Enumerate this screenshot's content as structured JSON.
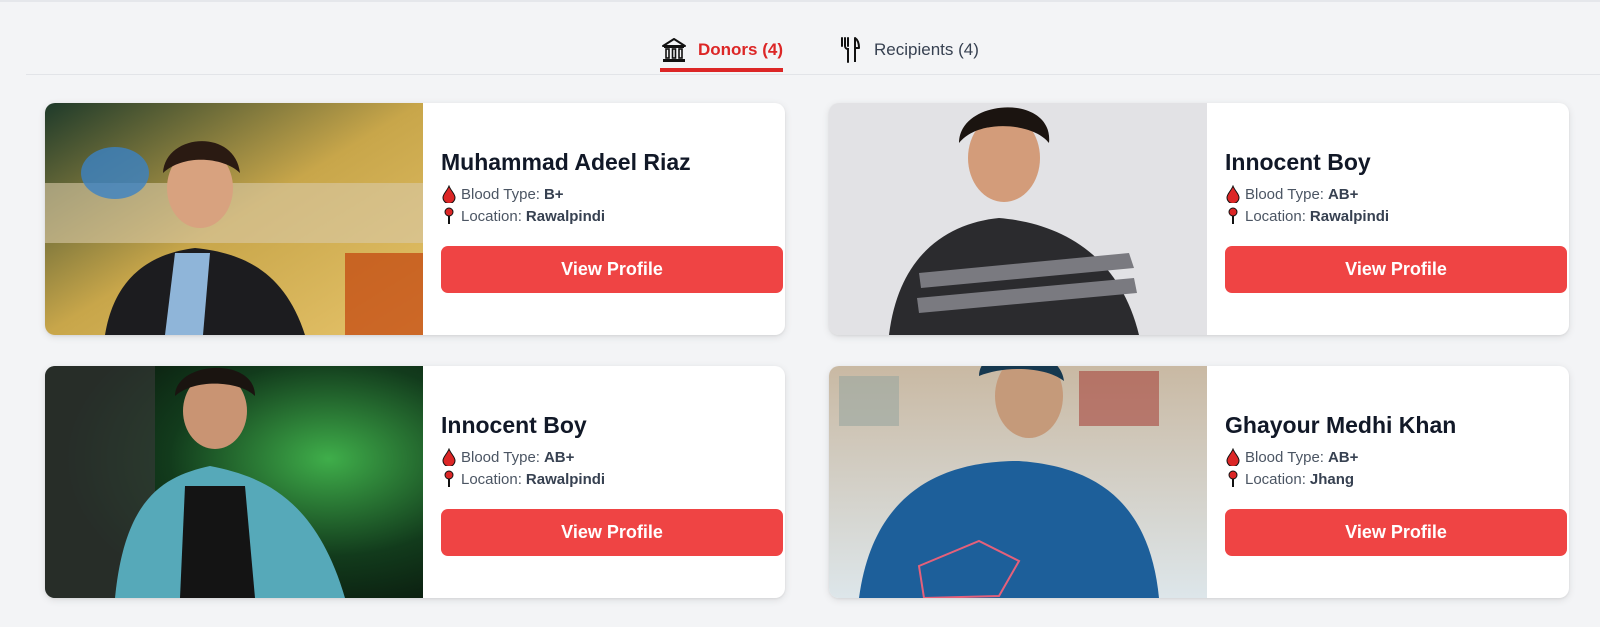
{
  "tabs": {
    "donors_label": "Donors (4)",
    "donors_icon": "bank-building-icon",
    "recipients_label": "Recipients (4)",
    "recipients_icon": "fork-knife-icon"
  },
  "labels": {
    "blood_type": "Blood Type:",
    "location": "Location:"
  },
  "donors": [
    {
      "name": "Muhammad Adeel Riaz",
      "blood_type": "B+",
      "location": "Rawalpindi",
      "button": "View Profile"
    },
    {
      "name": "Innocent Boy",
      "blood_type": "AB+",
      "location": "Rawalpindi",
      "button": "View Profile"
    },
    {
      "name": "Innocent Boy",
      "blood_type": "AB+",
      "location": "Rawalpindi",
      "button": "View Profile"
    },
    {
      "name": "Ghayour Medhi Khan",
      "blood_type": "AB+",
      "location": "Jhang",
      "button": "View Profile"
    }
  ],
  "colors": {
    "accent": "#dc2626",
    "button": "#ef4444",
    "background": "#f3f4f6"
  }
}
